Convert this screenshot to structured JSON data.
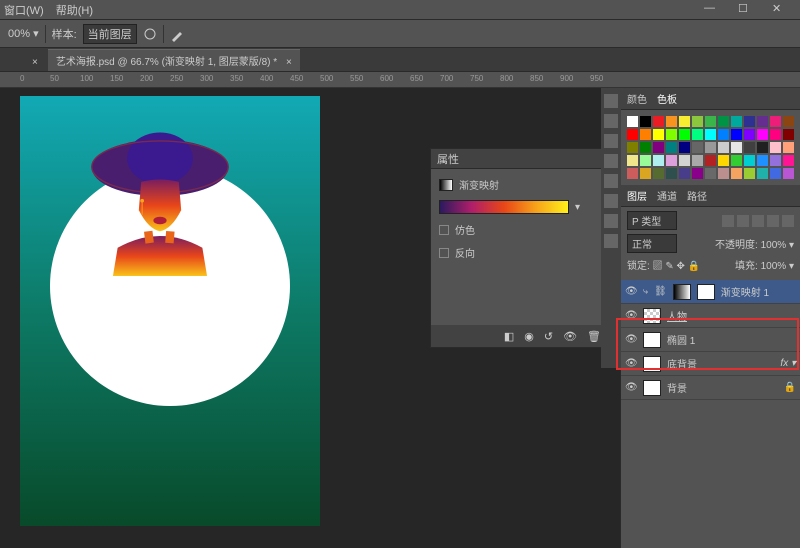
{
  "menu": {
    "window": "窗口(W)",
    "help": "帮助(H)"
  },
  "options": {
    "zoom": "00% ▾",
    "sample_label": "样本:",
    "sample_value": "当前图层"
  },
  "tab": {
    "title": "艺术海报.psd @ 66.7% (渐变映射 1, 图层蒙版/8) *",
    "close": "×"
  },
  "ruler": [
    "0",
    "50",
    "100",
    "150",
    "200",
    "250",
    "300",
    "350",
    "400",
    "450",
    "500",
    "550",
    "600",
    "650",
    "700",
    "750",
    "800",
    "850",
    "900",
    "950"
  ],
  "properties": {
    "panel_title": "属性",
    "type_label": "渐变映射",
    "dither": "仿色",
    "reverse": "反向"
  },
  "color_panel": {
    "tab_color": "颜色",
    "tab_swatches": "色板"
  },
  "swatch_colors": [
    "#fff",
    "#000",
    "#ec1c24",
    "#f7931e",
    "#f9ed32",
    "#8cc63f",
    "#39b54a",
    "#009245",
    "#00a99d",
    "#2e3192",
    "#662d91",
    "#ed1e79",
    "#8b4513",
    "#f00",
    "#ff8000",
    "#ff0",
    "#80ff00",
    "#0f0",
    "#00ff80",
    "#0ff",
    "#0080ff",
    "#00f",
    "#8000ff",
    "#f0f",
    "#ff0080",
    "#800000",
    "#808000",
    "#008000",
    "#800080",
    "#008080",
    "#000080",
    "#666",
    "#999",
    "#ccc",
    "#e6e6e6",
    "#404040",
    "#202020",
    "#ffc0cb",
    "#ffa07a",
    "#f0e68c",
    "#98fb98",
    "#afeeee",
    "#dda0dd",
    "#d3d3d3",
    "#a9a9a9",
    "#b22222",
    "#ffd700",
    "#32cd32",
    "#00ced1",
    "#1e90ff",
    "#9370db",
    "#ff1493",
    "#cd5c5c",
    "#daa520",
    "#556b2f",
    "#2f4f4f",
    "#483d8b",
    "#8b008b",
    "#696969",
    "#bc8f8f",
    "#f4a460",
    "#9acd32",
    "#20b2aa",
    "#4169e1",
    "#ba55d3"
  ],
  "layers_panel": {
    "tab_layers": "图层",
    "tab_channels": "通道",
    "tab_paths": "路径",
    "kind_label": "P 类型",
    "blend_mode": "正常",
    "opacity_label": "不透明度:",
    "opacity_value": "100%",
    "lock_label": "锁定:",
    "fill_label": "填充:",
    "fill_value": "100%",
    "layers": [
      {
        "name": "渐变映射 1",
        "selected": true,
        "clip": true
      },
      {
        "name": "人物",
        "selected": false,
        "underline": true
      },
      {
        "name": "椭圆 1",
        "selected": false
      },
      {
        "name": "底背景",
        "selected": false,
        "fx": "fx"
      },
      {
        "name": "背景",
        "selected": false,
        "lock": true
      }
    ]
  }
}
